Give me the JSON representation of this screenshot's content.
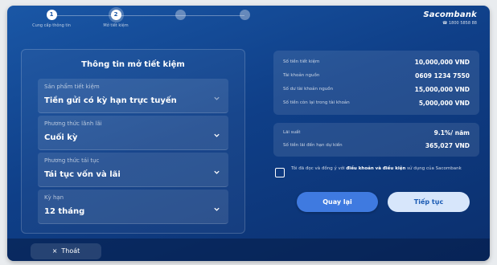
{
  "colors": {
    "background": "#0f3f88",
    "accent": "#3f7ae0",
    "secondary_button": "#d7e6fb"
  },
  "brand": {
    "name": "Sacombank",
    "phone": "1800 5858 88"
  },
  "stepper": {
    "steps": [
      {
        "number": "1",
        "label": "Cung cấp thông tin",
        "state": "done"
      },
      {
        "number": "2",
        "label": "Mở tiết kiệm",
        "state": "active"
      },
      {
        "number": "",
        "label": "",
        "state": "pending"
      },
      {
        "number": "",
        "label": "",
        "state": "pending"
      }
    ]
  },
  "form": {
    "title": "Thông tin mở tiết kiệm",
    "fields": [
      {
        "label": "Sản phẩm tiết kiệm",
        "value": "Tiền gửi có kỳ hạn trực tuyến",
        "icon": "chevron-down-icon"
      },
      {
        "label": "Phương thức lãnh lãi",
        "value": "Cuối kỳ",
        "icon": "chevron-down-icon"
      },
      {
        "label": "Phương thức tái tục",
        "value": "Tái tục vốn và lãi",
        "icon": "chevron-down-icon"
      },
      {
        "label": "Kỳ hạn",
        "value": "12 tháng",
        "icon": "chevron-down-icon"
      }
    ]
  },
  "summary": {
    "rows": [
      {
        "label": "Số tiền tiết kiệm",
        "value": "10,000,000 VND"
      },
      {
        "label": "Tài khoản nguồn",
        "value": "0609 1234 7550"
      },
      {
        "label": "Số dư tài khoản nguồn",
        "value": "15,000,000 VND"
      },
      {
        "label": "Số tiền còn lại trong tài khoản",
        "value": "5,000,000 VND"
      }
    ],
    "interest_rows": [
      {
        "label": "Lãi suất",
        "value": "9.1%/ năm"
      },
      {
        "label": "Số tiền lãi đến hạn dự kiến",
        "value": "365,027 VND"
      }
    ]
  },
  "terms": {
    "prefix": "Tôi đã đọc và đồng ý với ",
    "link": "điều khoản và điều kiện",
    "suffix": " sử dụng của Sacombank"
  },
  "actions": {
    "back_label": "Quay lại",
    "next_label": "Tiếp tục",
    "exit_label": "Thoát",
    "exit_icon": "×"
  }
}
